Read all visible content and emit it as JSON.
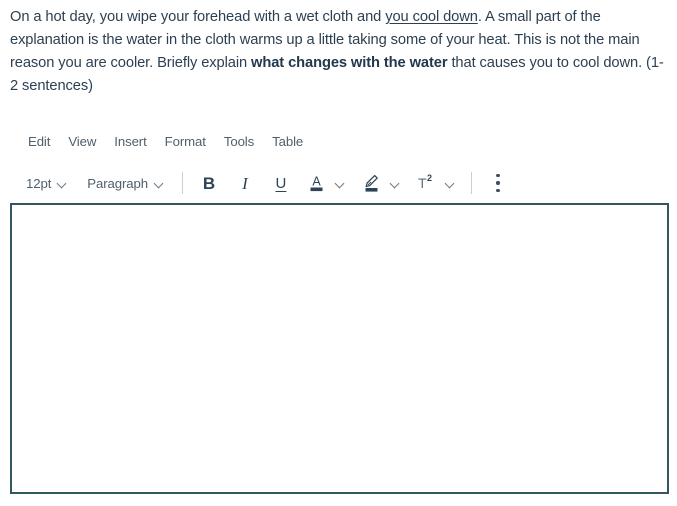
{
  "question": {
    "segments": [
      {
        "text": "On a hot day, you wipe your forehead with a wet cloth and ",
        "style": "normal"
      },
      {
        "text": "you cool down",
        "style": "underline"
      },
      {
        "text": ". A small part of the explanation is the water in the cloth warms up a little taking some of your heat. This is not the main reason you are cooler. Briefly explain ",
        "style": "normal"
      },
      {
        "text": "what changes with the water",
        "style": "bold"
      },
      {
        "text": " that causes you to cool down. (1-2 sentences)",
        "style": "normal"
      }
    ],
    "part1": "On a hot day, you wipe your forehead with a wet cloth and ",
    "underlined": "you cool down",
    "part2": ". A small part of the explanation is the water in the cloth warms up a little taking some of your heat. This is not the main reason you are cooler. Briefly explain ",
    "bolded": "what changes with the water",
    "part3": " that causes you to cool down. (1-2 sentences)"
  },
  "editor": {
    "menubar": [
      {
        "label": "Edit"
      },
      {
        "label": "View"
      },
      {
        "label": "Insert"
      },
      {
        "label": "Format"
      },
      {
        "label": "Tools"
      },
      {
        "label": "Table"
      }
    ],
    "toolbar": {
      "font_size": {
        "label": "12pt",
        "icon": "chevron-down-icon"
      },
      "block_format": {
        "label": "Paragraph",
        "icon": "chevron-down-icon"
      },
      "bold": {
        "label": "B",
        "icon": "bold-icon"
      },
      "italic": {
        "label": "I",
        "icon": "italic-icon"
      },
      "underline": {
        "label": "U",
        "icon": "underline-icon"
      },
      "text_color": {
        "label": "A",
        "icon": "text-color-icon",
        "swatch": "#2f4356"
      },
      "highlight_color": {
        "icon": "highlighter-icon",
        "swatch": "#2f4356"
      },
      "superscript": {
        "label": "T",
        "exponent": "2",
        "icon": "superscript-icon"
      },
      "more": {
        "icon": "kebab-menu-icon"
      }
    },
    "content": "",
    "placeholder": ""
  },
  "colors": {
    "text": "#2d4052",
    "menu_text": "#4e5f6d",
    "editor_border": "#31585e",
    "divider": "#c9cfd4",
    "icon": "#2f4356",
    "background": "#ffffff"
  }
}
